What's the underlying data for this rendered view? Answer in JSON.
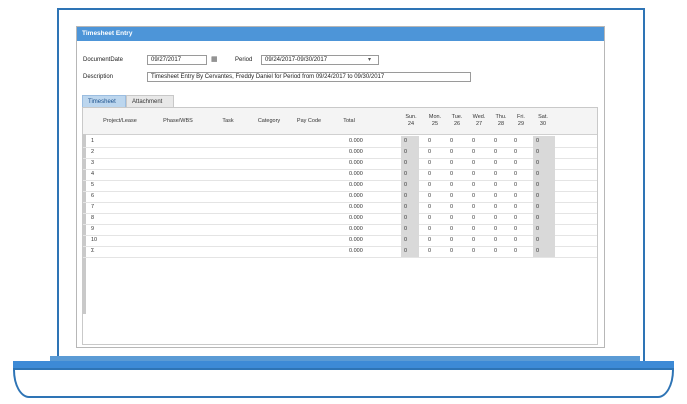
{
  "window": {
    "title": "Timesheet Entry"
  },
  "form": {
    "document_date_label": "DocumentDate",
    "document_date_value": "09/27/2017",
    "period_label": "Period",
    "period_value": "09/24/2017-09/30/2017",
    "description_label": "Description",
    "description_value": "Timesheet Entry By Cervantes, Freddy Daniel for Period from 09/24/2017 to 09/30/2017"
  },
  "tabs": [
    {
      "label": "Timesheet"
    },
    {
      "label": "Attachment"
    }
  ],
  "columns": {
    "project": "Project/Lease",
    "phase": "Phase/WBS",
    "task": "Task",
    "category": "Category",
    "pay_code": "Pay Code",
    "total": "Total",
    "days": [
      {
        "day": "Sun.",
        "date": "24"
      },
      {
        "day": "Mon.",
        "date": "25"
      },
      {
        "day": "Tue.",
        "date": "26"
      },
      {
        "day": "Wed.",
        "date": "27"
      },
      {
        "day": "Thu.",
        "date": "28"
      },
      {
        "day": "Fri.",
        "date": "29"
      },
      {
        "day": "Sat.",
        "date": "30"
      }
    ]
  },
  "rows": [
    {
      "num": "1",
      "total": "0.000",
      "values": [
        "0",
        "0",
        "0",
        "0",
        "0",
        "0",
        "0"
      ]
    },
    {
      "num": "2",
      "total": "0.000",
      "values": [
        "0",
        "0",
        "0",
        "0",
        "0",
        "0",
        "0"
      ]
    },
    {
      "num": "3",
      "total": "0.000",
      "values": [
        "0",
        "0",
        "0",
        "0",
        "0",
        "0",
        "0"
      ]
    },
    {
      "num": "4",
      "total": "0.000",
      "values": [
        "0",
        "0",
        "0",
        "0",
        "0",
        "0",
        "0"
      ]
    },
    {
      "num": "5",
      "total": "0.000",
      "values": [
        "0",
        "0",
        "0",
        "0",
        "0",
        "0",
        "0"
      ]
    },
    {
      "num": "6",
      "total": "0.000",
      "values": [
        "0",
        "0",
        "0",
        "0",
        "0",
        "0",
        "0"
      ]
    },
    {
      "num": "7",
      "total": "0.000",
      "values": [
        "0",
        "0",
        "0",
        "0",
        "0",
        "0",
        "0"
      ]
    },
    {
      "num": "8",
      "total": "0.000",
      "values": [
        "0",
        "0",
        "0",
        "0",
        "0",
        "0",
        "0"
      ]
    },
    {
      "num": "9",
      "total": "0.000",
      "values": [
        "0",
        "0",
        "0",
        "0",
        "0",
        "0",
        "0"
      ]
    },
    {
      "num": "10",
      "total": "0.000",
      "values": [
        "0",
        "0",
        "0",
        "0",
        "0",
        "0",
        "0"
      ]
    },
    {
      "num": "Σ",
      "total": "0.000",
      "values": [
        "0",
        "0",
        "0",
        "0",
        "0",
        "0",
        "0"
      ]
    }
  ],
  "colors": {
    "frame": "#2e74b5",
    "titlebar": "#4d95d8",
    "tab_active": "#bcd6ee"
  }
}
